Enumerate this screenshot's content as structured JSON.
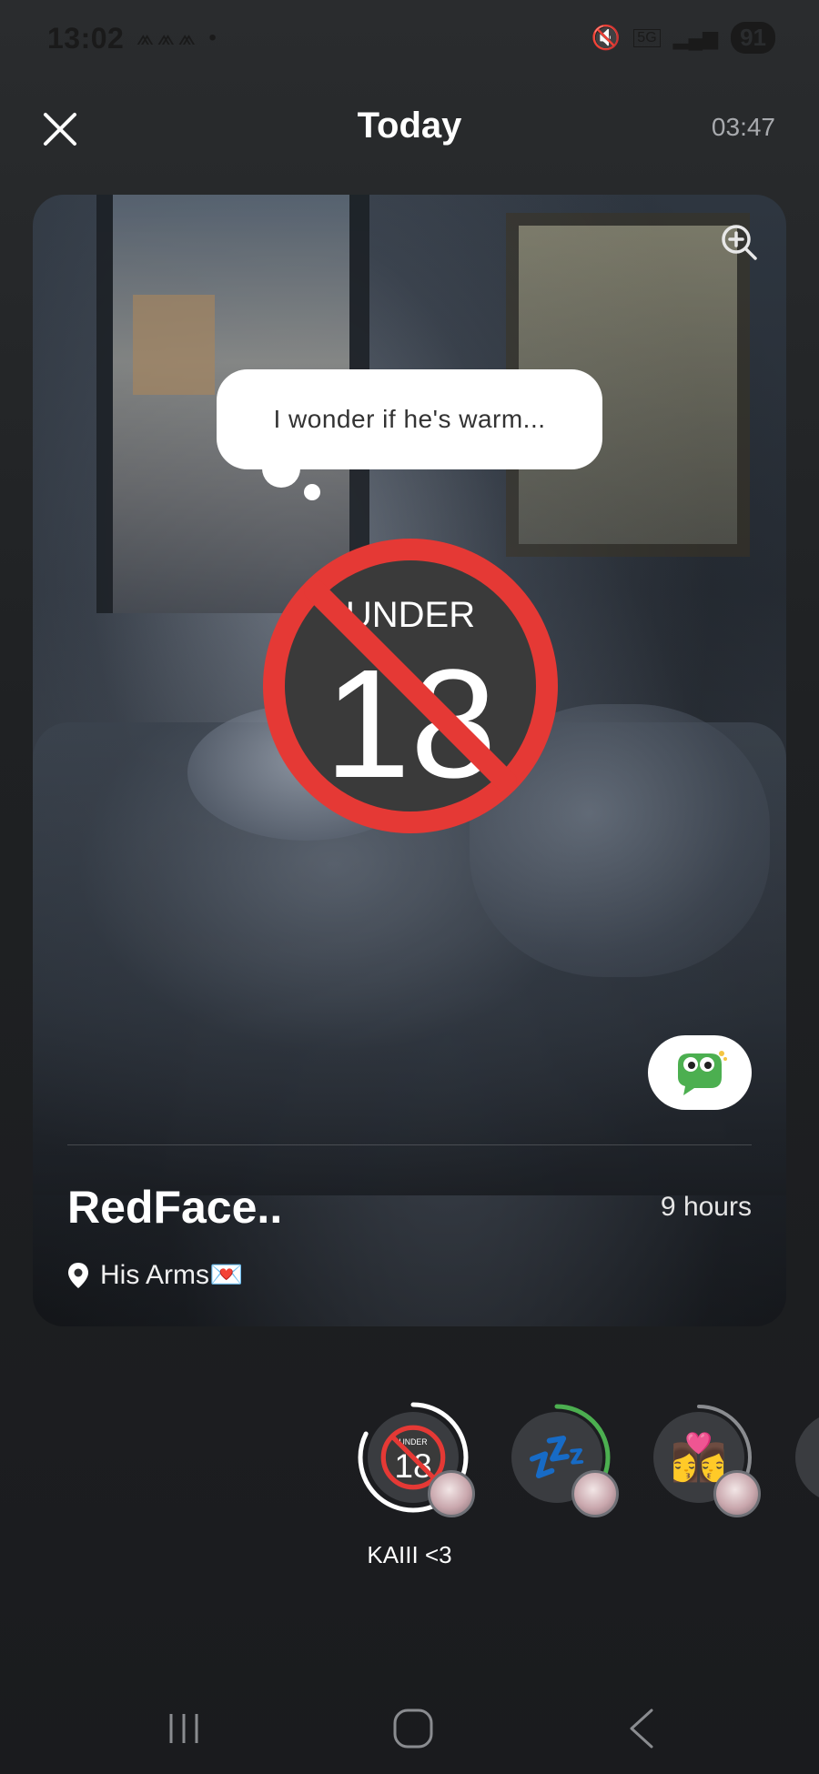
{
  "status_bar": {
    "time": "13:02",
    "notification_icons": "⩕⩕⩕ •",
    "network": "5G",
    "battery": "91"
  },
  "header": {
    "title": "Today",
    "timer": "03:47"
  },
  "post": {
    "thought_bubble": "I wonder if he's warm...",
    "badge_label": "UNDER",
    "badge_number": "18",
    "name": "RedFace..",
    "duration": "9 hours",
    "location": "His Arms💌"
  },
  "stories": {
    "selected_label": "KAIII <3",
    "items": [
      {
        "icon": "under18-icon"
      },
      {
        "icon": "sleeping-zzz-icon",
        "emoji": "💤"
      },
      {
        "icon": "kiss-couple-icon",
        "emoji": "👩‍❤️‍💋‍👩"
      }
    ]
  },
  "colors": {
    "badge_red": "#e53935",
    "ring_green": "#4caf50",
    "background": "#1f2123"
  }
}
